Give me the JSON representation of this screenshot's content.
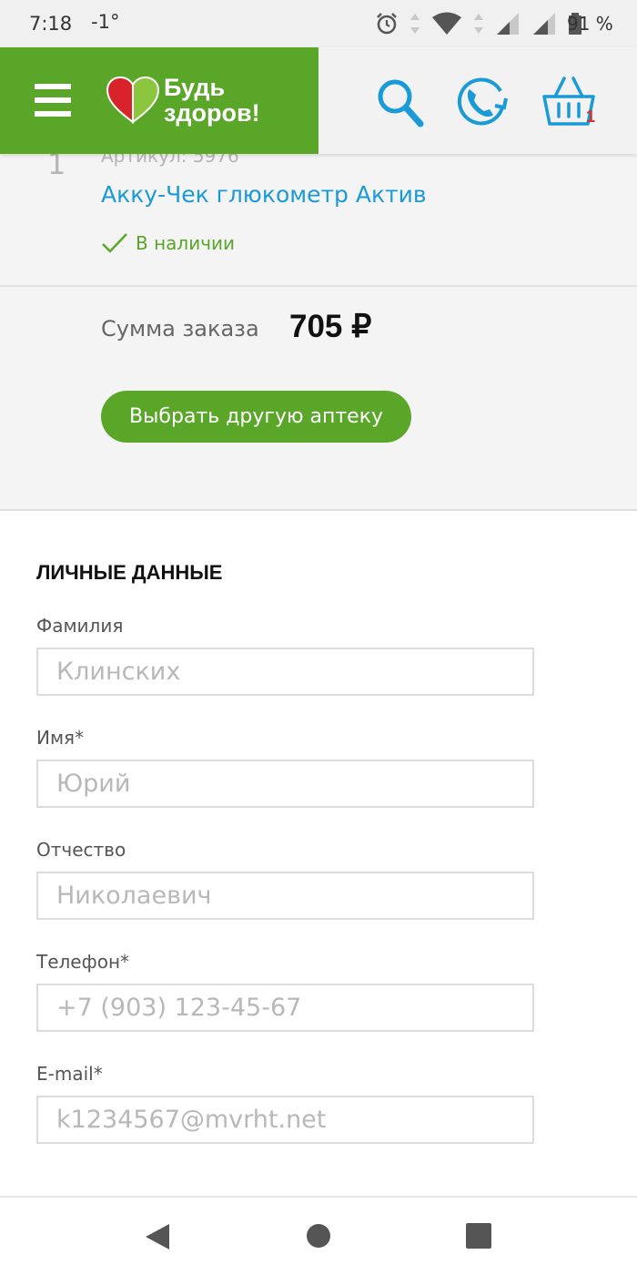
{
  "status_bar": {
    "time": "7:18",
    "temperature": "-1°",
    "battery_percent": "91 %"
  },
  "header": {
    "brand": {
      "line1": "Будь",
      "line2": "здоров!"
    },
    "cart_count": "1",
    "colors": {
      "brand_green": "#5aa629",
      "icon_blue": "#1a9ad6",
      "badge_red": "#d0302a"
    }
  },
  "order": {
    "item_number": "1",
    "article": "Артикул: 5976",
    "product_name": "Акку-Чек глюкометр Актив",
    "stock_status": "В наличии",
    "sum_label": "Сумма заказа",
    "sum_value": "705 ₽",
    "choose_pharmacy_button": "Выбрать другую аптеку"
  },
  "personal": {
    "title": "ЛИЧНЫЕ ДАННЫЕ",
    "fields": [
      {
        "label": "Фамилия",
        "placeholder": "Клинских"
      },
      {
        "label": "Имя*",
        "placeholder": "Юрий"
      },
      {
        "label": "Отчество",
        "placeholder": "Николаевич"
      },
      {
        "label": "Телефон*",
        "placeholder": "+7 (903) 123-45-67"
      },
      {
        "label": "E-mail*",
        "placeholder": "k1234567@mvrht.net"
      }
    ]
  },
  "icons": {
    "menu": "menu-icon",
    "search": "search-icon",
    "callback": "phone-callback-icon",
    "cart": "basket-icon",
    "stock": "check-icon",
    "nav_back": "back-triangle-icon",
    "nav_home": "home-circle-icon",
    "nav_recents": "recents-square-icon"
  }
}
